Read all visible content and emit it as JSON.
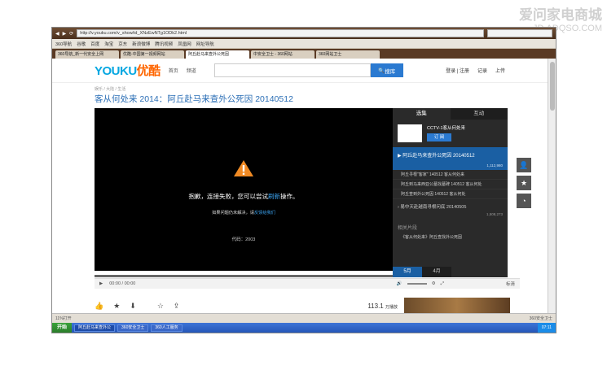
{
  "watermark": {
    "line1": "爱问家电商城",
    "line2": "JD.ADQSO.COM"
  },
  "browser": {
    "url": "http://v.youku.com/v_show/id_XNzEwNTg1ODk2.html",
    "bookmarks": [
      "360导航",
      "谷歌",
      "百度",
      "淘宝",
      "京东",
      "新浪微博",
      "腾讯视频",
      "凤凰网",
      "网址导航"
    ],
    "tabs": [
      "360导航_新一代安全上网",
      "优酷-中国第一视频网站",
      "阿丘赴马来查外公死因",
      "中安全卫士 - 360网站",
      "360网站卫士"
    ]
  },
  "youku": {
    "logo_en": "YOUKU",
    "logo_cn": "优酷",
    "nav": [
      "首页",
      "频道"
    ],
    "search_button": "搜库",
    "user_links": [
      "登录 | 注册",
      "记录",
      "上传"
    ],
    "breadcrumb": "娱乐 / 大陆 / 生活",
    "video_title": "客从何处来 2014：阿丘赴马来查外公死因 20140512"
  },
  "player": {
    "error_main_before": "抱歉，连接失败，您可以尝试",
    "error_link": "刷新",
    "error_main_after": "操作。",
    "error_sub_before": "如果问题仍未解决，请",
    "error_sub_link": "反馈给我们",
    "error_code": "代码：2003",
    "time": "00:00 / 00:00",
    "quality": "标清"
  },
  "sidepanel": {
    "tabs": [
      "选集",
      "互动"
    ],
    "channel": "CCTV-1客从何处来",
    "subscribe": "订 阅",
    "current_episode": "阿丘赴马来查外公死因 20140512",
    "current_count": "1,112,980",
    "sub_items": [
      "阿丘寻根\"客家\" 140512 客从何处来",
      "阿丘到马来西亚公墓找墓碑 140512 客从何处",
      "阿丘查到外公死因 140512 客从何处"
    ],
    "next_episode": "易中天赴越南寻根问底 20140505",
    "next_count": "1,508,273",
    "related_heading": "相关片段",
    "related_item": "《客从何处来》阿丘查找外公死因",
    "months": [
      "5月",
      "4月"
    ]
  },
  "actionbar": {
    "views": "113.1",
    "views_unit": "万播放"
  },
  "status": {
    "left": "11%打开",
    "task1": "阿丘赴马来查外公",
    "task2": "360安全卫士",
    "task3": "360人工服务",
    "tray": "07:11",
    "ie": "360安全卫士"
  },
  "colors": {
    "youku_blue": "#06a7e1",
    "link_blue": "#2c6fb6",
    "panel_active": "#1a5fa3"
  }
}
